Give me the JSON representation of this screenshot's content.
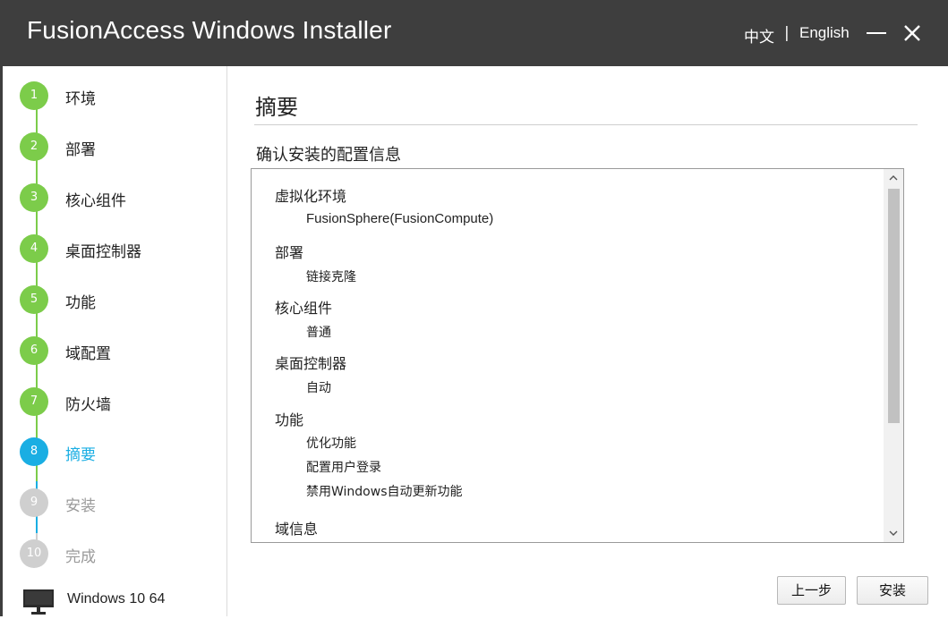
{
  "window": {
    "title": "FusionAccess Windows Installer",
    "lang_zh": "中文",
    "lang_sep": "|",
    "lang_en": "English",
    "minimize_icon": "minimize-icon",
    "close_icon": "close-icon"
  },
  "colors": {
    "titlebar": "#3e3e3e",
    "done": "#7ccc4a",
    "active": "#1aaee3",
    "pending": "#cfcfcf"
  },
  "steps": [
    {
      "num": "1",
      "label": "环境",
      "state": "done"
    },
    {
      "num": "2",
      "label": "部署",
      "state": "done"
    },
    {
      "num": "3",
      "label": "核心组件",
      "state": "done"
    },
    {
      "num": "4",
      "label": "桌面控制器",
      "state": "done"
    },
    {
      "num": "5",
      "label": "功能",
      "state": "done"
    },
    {
      "num": "6",
      "label": "域配置",
      "state": "done"
    },
    {
      "num": "7",
      "label": "防火墙",
      "state": "done"
    },
    {
      "num": "8",
      "label": "摘要",
      "state": "active"
    },
    {
      "num": "9",
      "label": "安装",
      "state": "pending"
    },
    {
      "num": "10",
      "label": "完成",
      "state": "pending"
    }
  ],
  "os": {
    "icon": "monitor-icon",
    "label": "Windows 10 64"
  },
  "main": {
    "title": "摘要",
    "subtitle": "确认安装的配置信息"
  },
  "summary": {
    "sections": [
      {
        "title": "虚拟化环境",
        "items": [
          "FusionSphere(FusionCompute)"
        ]
      },
      {
        "title": "部署",
        "items": [
          "链接克隆"
        ]
      },
      {
        "title": "核心组件",
        "items": [
          "普通"
        ]
      },
      {
        "title": "桌面控制器",
        "items": [
          "自动"
        ]
      },
      {
        "title": "功能",
        "items": [
          "优化功能",
          "配置用户登录",
          "禁用Windows自动更新功能"
        ]
      },
      {
        "title": "域信息",
        "items": []
      }
    ]
  },
  "buttons": {
    "prev": "上一步",
    "install": "安装"
  }
}
